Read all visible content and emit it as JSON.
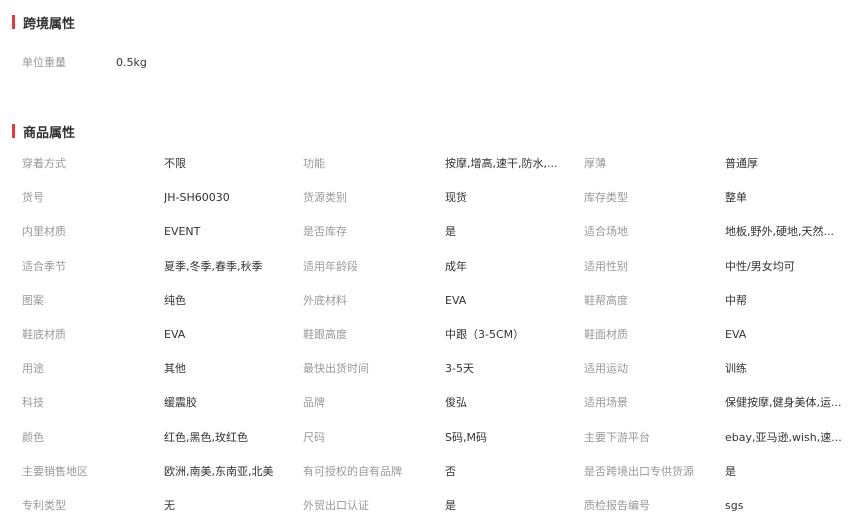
{
  "cross_border": {
    "title": "跨境属性",
    "rows": [
      {
        "label": "单位重量",
        "value": "0.5kg"
      }
    ]
  },
  "product_attrs": {
    "title": "商品属性",
    "rows": [
      [
        {
          "label": "穿着方式",
          "value": "不限"
        },
        {
          "label": "功能",
          "value": "按摩,增高,速干,防水,..."
        },
        {
          "label": "厚薄",
          "value": "普通厚"
        }
      ],
      [
        {
          "label": "货号",
          "value": "JH-SH60030"
        },
        {
          "label": "货源类别",
          "value": "现货"
        },
        {
          "label": "库存类型",
          "value": "整单"
        }
      ],
      [
        {
          "label": "内里材质",
          "value": "EVENT"
        },
        {
          "label": "是否库存",
          "value": "是"
        },
        {
          "label": "适合场地",
          "value": "地板,野外,硬地,天然..."
        }
      ],
      [
        {
          "label": "适合季节",
          "value": "夏季,冬季,春季,秋季"
        },
        {
          "label": "适用年龄段",
          "value": "成年"
        },
        {
          "label": "适用性别",
          "value": "中性/男女均可"
        }
      ],
      [
        {
          "label": "图案",
          "value": "纯色"
        },
        {
          "label": "外底材料",
          "value": "EVA"
        },
        {
          "label": "鞋帮高度",
          "value": "中帮"
        }
      ],
      [
        {
          "label": "鞋底材质",
          "value": "EVA"
        },
        {
          "label": "鞋跟高度",
          "value": "中跟（3-5CM）"
        },
        {
          "label": "鞋面材质",
          "value": "EVA"
        }
      ],
      [
        {
          "label": "用途",
          "value": "其他"
        },
        {
          "label": "最快出货时间",
          "value": "3-5天"
        },
        {
          "label": "适用运动",
          "value": "训练"
        }
      ],
      [
        {
          "label": "科技",
          "value": "缓震胶"
        },
        {
          "label": "品牌",
          "value": "俊弘"
        },
        {
          "label": "适用场景",
          "value": "保健按摩,健身美体,运..."
        }
      ],
      [
        {
          "label": "颜色",
          "value": "红色,黑色,玫红色"
        },
        {
          "label": "尺码",
          "value": "S码,M码"
        },
        {
          "label": "主要下游平台",
          "value": "ebay,亚马逊,wish,速..."
        }
      ],
      [
        {
          "label": "主要销售地区",
          "value": "欧洲,南美,东南亚,北美"
        },
        {
          "label": "有可授权的自有品牌",
          "value": "否"
        },
        {
          "label": "是否跨境出口专供货源",
          "value": "是"
        }
      ],
      [
        {
          "label": "专利类型",
          "value": "无"
        },
        {
          "label": "外贸出口认证",
          "value": "是"
        },
        {
          "label": "质检报告编号",
          "value": "sgs"
        }
      ]
    ]
  }
}
